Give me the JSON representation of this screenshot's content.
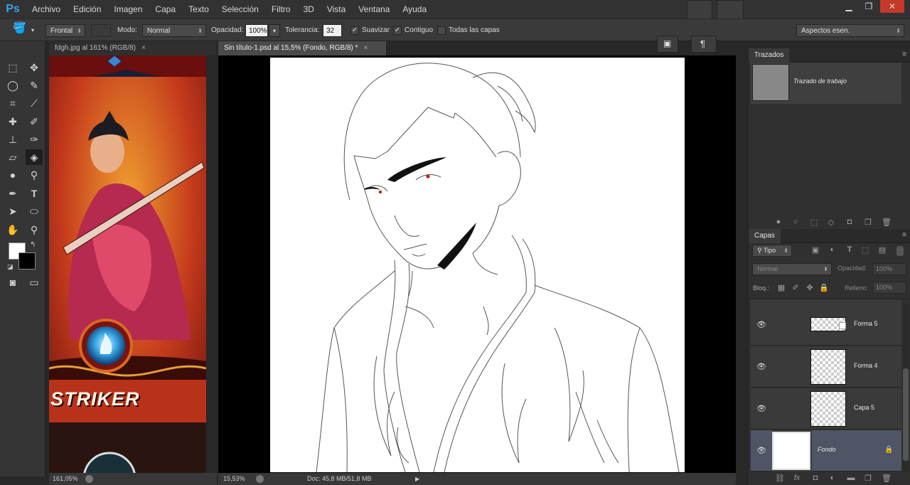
{
  "app": {
    "logo": "Ps"
  },
  "menu": [
    "Archivo",
    "Edición",
    "Imagen",
    "Capa",
    "Texto",
    "Selección",
    "Filtro",
    "3D",
    "Vista",
    "Ventana",
    "Ayuda"
  ],
  "window_controls": {
    "minimize": "▁",
    "restore": "❐",
    "close": "✕"
  },
  "options": {
    "fill_source": "Frontal",
    "mode_label": "Modo:",
    "mode_value": "Normal",
    "opacity_label": "Opacidad:",
    "opacity_value": "100%",
    "tolerance_label": "Tolerancia:",
    "tolerance_value": "32",
    "smooth_label": "Suavizar",
    "contiguous_label": "Contiguo",
    "all_layers_label": "Todas las capas",
    "workspace": "Aspectos esen."
  },
  "tabs": [
    {
      "label": "fdgh.jpg al 161% (RGB/8)",
      "close": "×"
    },
    {
      "label": "Sin título-1.psd al 15,5% (Fondo, RGB/8) *",
      "close": "×"
    }
  ],
  "left_doc": {
    "banner_text": "STRIKER"
  },
  "paths_panel": {
    "title": "Trazados",
    "work_path": "Trazado de trabajo"
  },
  "layers_panel": {
    "title": "Capas",
    "filter": "Tipo",
    "blend": "Normal",
    "opacity_label": "Opacidad:",
    "opacity_value": "100%",
    "lock_label": "Bloq.:",
    "fill_label": "Relleno:",
    "fill_value": "100%",
    "layers": [
      {
        "name": "Forma 5"
      },
      {
        "name": "Forma 4"
      },
      {
        "name": "Capa 5"
      },
      {
        "name": "Fondo"
      }
    ]
  },
  "status": {
    "left_zoom": "161,05%",
    "main_zoom": "15,53%",
    "doc_info": "Doc: 45,8 MB/51,8 MB"
  }
}
